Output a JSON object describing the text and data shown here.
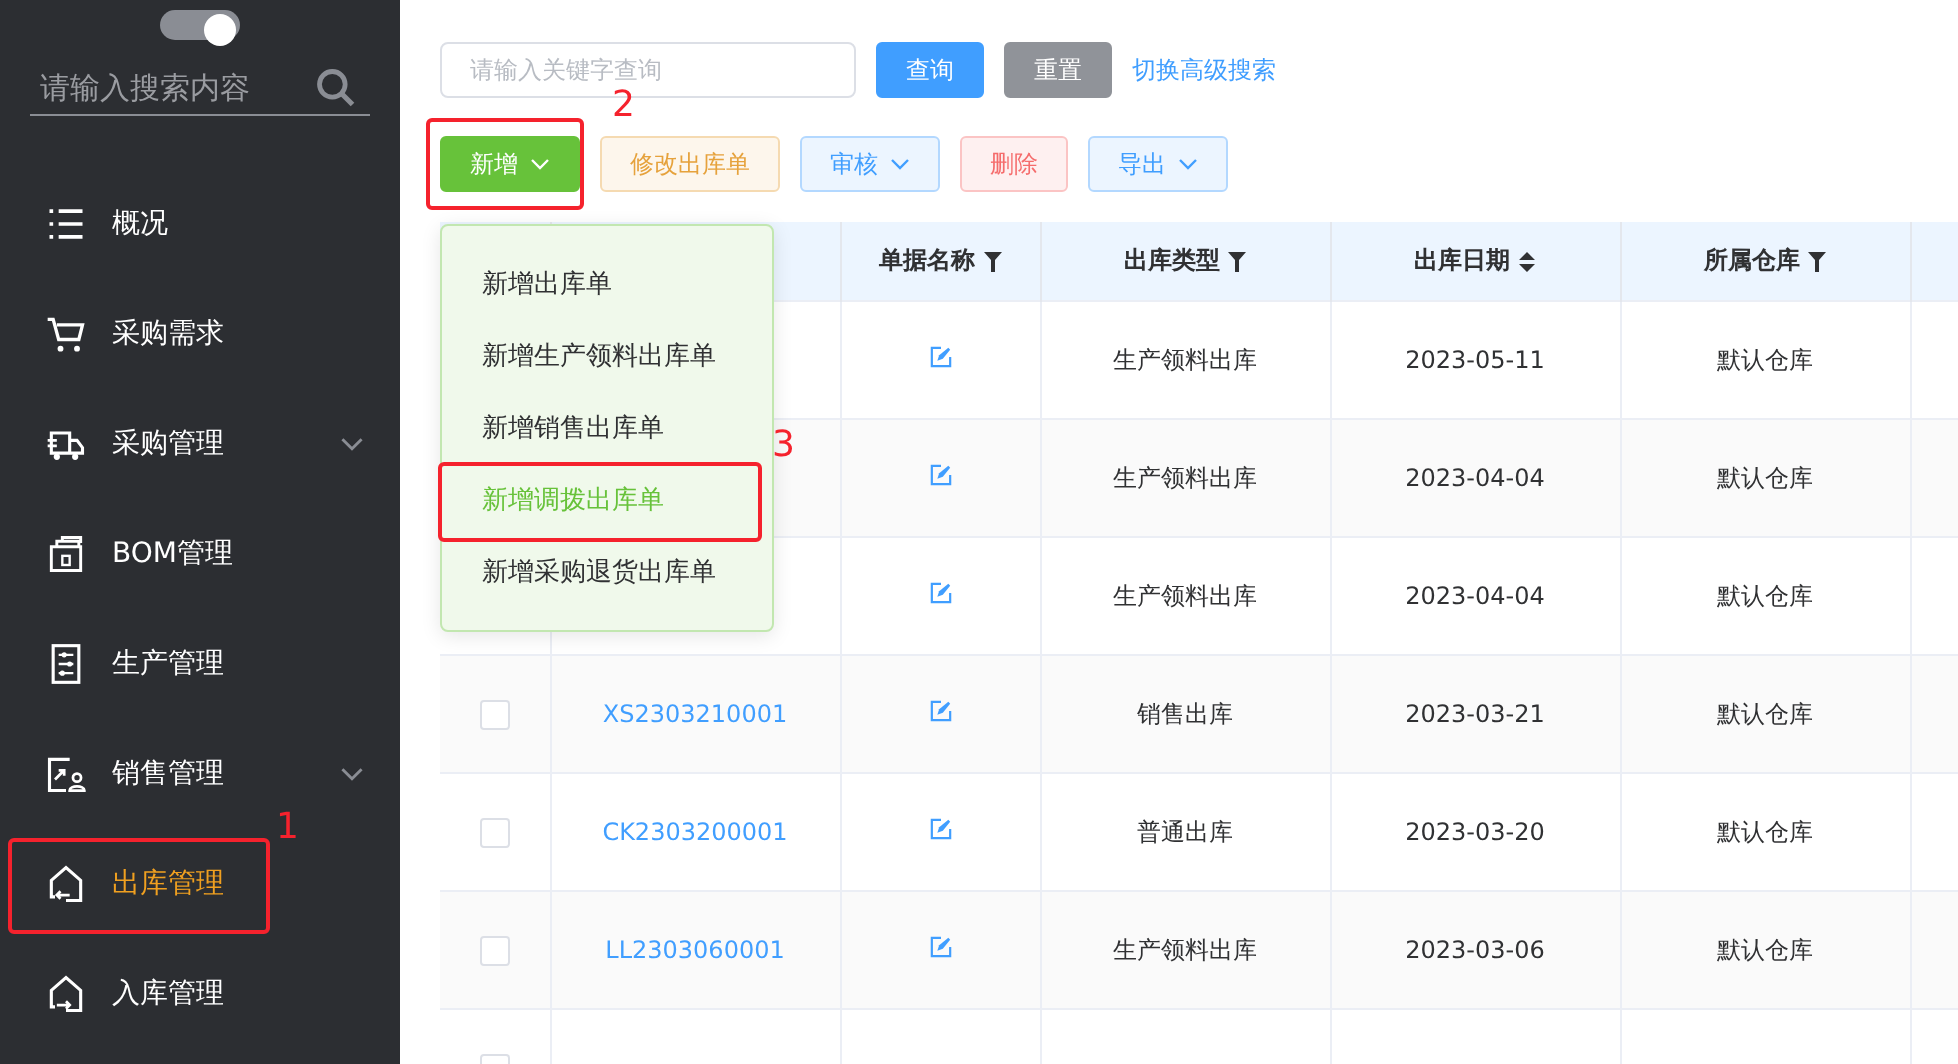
{
  "sidebar": {
    "theme_switch": {
      "on": true
    },
    "search": {
      "placeholder": "请输入搜索内容"
    },
    "items": [
      {
        "label": "概况",
        "submenu": false,
        "selected": false
      },
      {
        "label": "采购需求",
        "submenu": false,
        "selected": false
      },
      {
        "label": "采购管理",
        "submenu": true,
        "selected": false
      },
      {
        "label": "BOM管理",
        "submenu": false,
        "selected": false
      },
      {
        "label": "生产管理",
        "submenu": false,
        "selected": false
      },
      {
        "label": "销售管理",
        "submenu": true,
        "selected": false
      },
      {
        "label": "出库管理",
        "submenu": false,
        "selected": true,
        "annotation": "1"
      },
      {
        "label": "入库管理",
        "submenu": false,
        "selected": false
      }
    ]
  },
  "search_bar": {
    "placeholder": "请输入关键字查询",
    "buttons": [
      {
        "label": "查询",
        "kind": "primary"
      },
      {
        "label": "重置",
        "kind": "info"
      }
    ],
    "link": "切换高级搜索"
  },
  "toolbar": [
    {
      "label": "新增",
      "kind": "success",
      "caret": true,
      "annotation": "2"
    },
    {
      "label": "修改出库单",
      "kind": "warning",
      "caret": false
    },
    {
      "label": "审核",
      "kind": "plain-primary",
      "caret": true
    },
    {
      "label": "删除",
      "kind": "danger",
      "caret": false
    },
    {
      "label": "导出",
      "kind": "plain-primary",
      "caret": true
    }
  ],
  "add_menu": {
    "expanded": true,
    "items": [
      {
        "label": "新增出库单",
        "selected": false
      },
      {
        "label": "新增生产领料出库单",
        "selected": false
      },
      {
        "label": "新增销售出库单",
        "selected": false
      },
      {
        "label": "新增调拨出库单",
        "selected": true,
        "annotation": "3"
      },
      {
        "label": "新增采购退货出库单",
        "selected": false
      }
    ]
  },
  "table": {
    "columns": [
      {
        "label": "单据名称",
        "kind": "filter"
      },
      {
        "label": "出库类型",
        "kind": "filter"
      },
      {
        "label": "出库日期",
        "kind": "sort"
      },
      {
        "label": "所属仓库",
        "kind": "filter"
      }
    ],
    "rows": [
      {
        "type": "生产领料出库",
        "date": "2023-05-11",
        "warehouse": "默认仓库"
      },
      {
        "type": "生产领料出库",
        "date": "2023-04-04",
        "warehouse": "默认仓库"
      },
      {
        "type": "生产领料出库",
        "date": "2023-04-04",
        "warehouse": "默认仓库"
      },
      {
        "checked": false,
        "code": "XS2303210001",
        "type": "销售出库",
        "date": "2023-03-21",
        "warehouse": "默认仓库"
      },
      {
        "checked": false,
        "code": "CK2303200001",
        "type": "普通出库",
        "date": "2023-03-20",
        "warehouse": "默认仓库"
      },
      {
        "checked": false,
        "code": "LL2303060001",
        "type": "生产领料出库",
        "date": "2023-03-06",
        "warehouse": "默认仓库"
      },
      {
        "checked": false
      }
    ]
  }
}
